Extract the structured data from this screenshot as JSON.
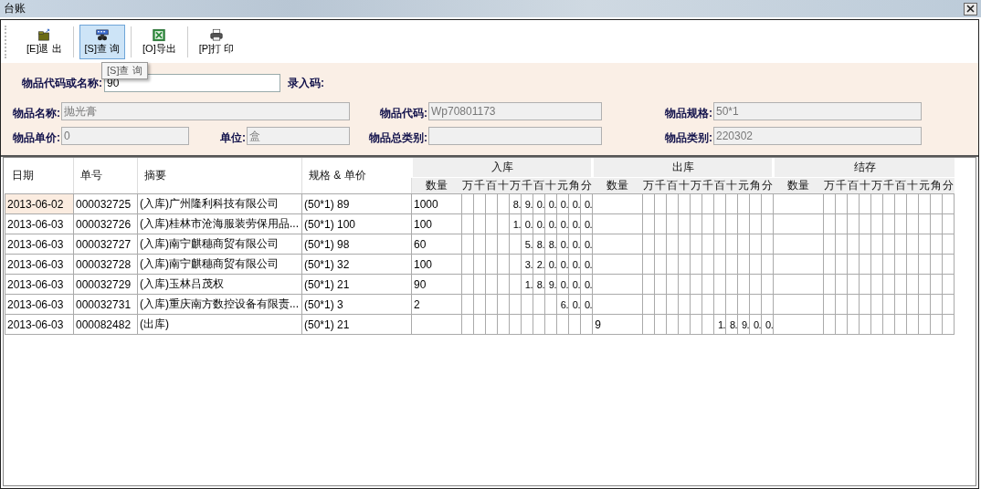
{
  "window": {
    "title": "台账"
  },
  "toolbar": {
    "buttons": [
      {
        "label": "[E]退 出",
        "selected": false
      },
      {
        "label": "[S]查 询",
        "selected": true
      },
      {
        "label": "[O]导出",
        "selected": false
      },
      {
        "label": "[P]打 印",
        "selected": false
      }
    ],
    "tooltip": "[S]查 询"
  },
  "search": {
    "label": "物品代码或名称:",
    "value": "90",
    "code_label": "录入码:"
  },
  "details": [
    [
      {
        "label": "物品名称:",
        "value": "抛光膏"
      },
      {
        "label": "物品代码:",
        "value": "Wp70801173"
      },
      {
        "label": "物品规格:",
        "value": "50*1"
      }
    ],
    [
      {
        "label": "物品单价:",
        "value": "0"
      },
      {
        "label": "单位:",
        "value": "盒"
      },
      {
        "label": "物品总类别:"
      },
      {
        "label": "物品类别:",
        "value": "220302"
      }
    ]
  ],
  "table": {
    "columns": [
      "日期",
      "单号",
      "摘要",
      "规格 & 单价"
    ],
    "groups": [
      {
        "title": "入库",
        "qty_label": "数量",
        "units": [
          "万",
          "千",
          "百",
          "十",
          "万",
          "千",
          "百",
          "十",
          "元",
          "角",
          "分"
        ]
      },
      {
        "title": "出库",
        "qty_label": "数量",
        "units": [
          "万",
          "千",
          "百",
          "十",
          "万",
          "千",
          "百",
          "十",
          "元",
          "角",
          "分"
        ]
      },
      {
        "title": "结存",
        "qty_label": "数量",
        "units": [
          "万",
          "千",
          "百",
          "十",
          "万",
          "千",
          "百",
          "十",
          "元",
          "角",
          "分"
        ]
      }
    ],
    "rows": [
      {
        "selected": true,
        "date": "2013-06-02",
        "number": "000032725",
        "summary": "(入库)广州隆利科技有限公司",
        "spec": "(50*1) 89",
        "in": {
          "qty": "1000",
          "digits": [
            "8.",
            "9.",
            "0.",
            "0.",
            "0.",
            "0.",
            "0."
          ]
        }
      },
      {
        "selected": false,
        "date": "2013-06-03",
        "number": "000032726",
        "summary": "(入库)桂林市沧海服装劳保用品...",
        "spec": "(50*1) 100",
        "in": {
          "qty": "100",
          "digits": [
            "1.",
            "0.",
            "0.",
            "0.",
            "0.",
            "0.",
            "0."
          ]
        }
      },
      {
        "selected": false,
        "date": "2013-06-03",
        "number": "000032727",
        "summary": "(入库)南宁麒穗商贸有限公司",
        "spec": "(50*1) 98",
        "in": {
          "qty": "60",
          "digits": [
            "5.",
            "8.",
            "8.",
            "0.",
            "0.",
            "0."
          ]
        }
      },
      {
        "selected": false,
        "date": "2013-06-03",
        "number": "000032728",
        "summary": "(入库)南宁麒穗商贸有限公司",
        "spec": "(50*1) 32",
        "in": {
          "qty": "100",
          "digits": [
            "3.",
            "2.",
            "0.",
            "0.",
            "0.",
            "0."
          ]
        }
      },
      {
        "selected": false,
        "date": "2013-06-03",
        "number": "000032729",
        "summary": "(入库)玉林吕茂权",
        "spec": "(50*1) 21",
        "in": {
          "qty": "90",
          "digits": [
            "1.",
            "8.",
            "9.",
            "0.",
            "0.",
            "0."
          ]
        }
      },
      {
        "selected": false,
        "date": "2013-06-03",
        "number": "000032731",
        "summary": "(入库)重庆南方数控设备有限责...",
        "spec": "(50*1) 3",
        "in": {
          "qty": "2",
          "digits": [
            "6.",
            "0.",
            "0."
          ]
        }
      },
      {
        "selected": false,
        "date": "2013-06-03",
        "number": "000082482",
        "summary": "(出库)",
        "spec": "(50*1) 21",
        "out": {
          "qty": "9",
          "digits": [
            "1.",
            "8.",
            "9.",
            "0.",
            "0."
          ]
        }
      }
    ]
  }
}
